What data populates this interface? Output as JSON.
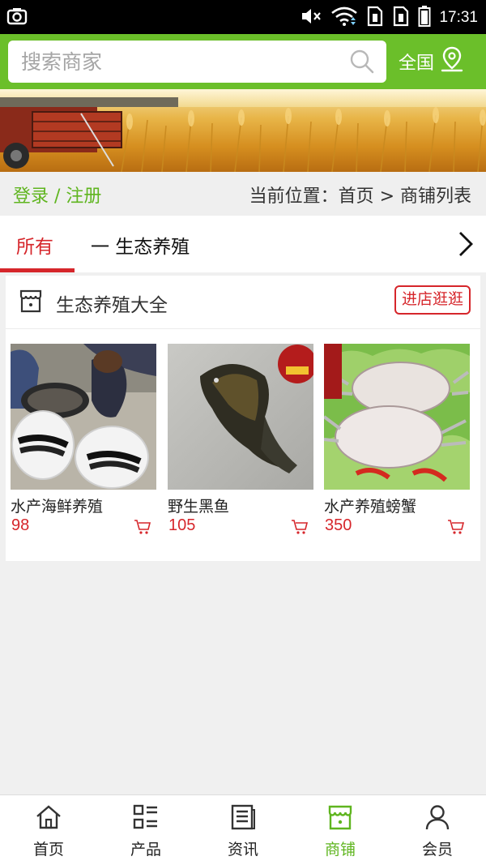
{
  "status_bar": {
    "time": "17:31",
    "icons": [
      "screenshot-icon",
      "mute-icon",
      "wifi-icon",
      "sim-icon",
      "sim-icon",
      "battery-icon"
    ]
  },
  "header": {
    "search_placeholder": "搜索商家",
    "region_label": "全国",
    "accent_color": "#6bbf2a"
  },
  "breadcrumb": {
    "login_label": "登录 / 注册",
    "location_text": "当前位置：首页 > 商铺列表"
  },
  "tabs": {
    "active_label": "所有",
    "category_label": "一 生态养殖"
  },
  "shop": {
    "title": "生态养殖大全",
    "enter_label": "进店逛逛",
    "products": [
      {
        "name": "水产海鲜养殖",
        "price": "98"
      },
      {
        "name": "野生黑鱼",
        "price": "105"
      },
      {
        "name": "水产养殖螃蟹",
        "price": "350"
      }
    ]
  },
  "bottom_nav": [
    {
      "label": "首页",
      "icon": "home-icon",
      "active": false
    },
    {
      "label": "产品",
      "icon": "product-grid-icon",
      "active": false
    },
    {
      "label": "资讯",
      "icon": "news-icon",
      "active": false
    },
    {
      "label": "商铺",
      "icon": "store-icon",
      "active": true
    },
    {
      "label": "会员",
      "icon": "member-icon",
      "active": false
    }
  ],
  "colors": {
    "brand_green": "#5fb51f",
    "highlight_red": "#d6262b"
  }
}
